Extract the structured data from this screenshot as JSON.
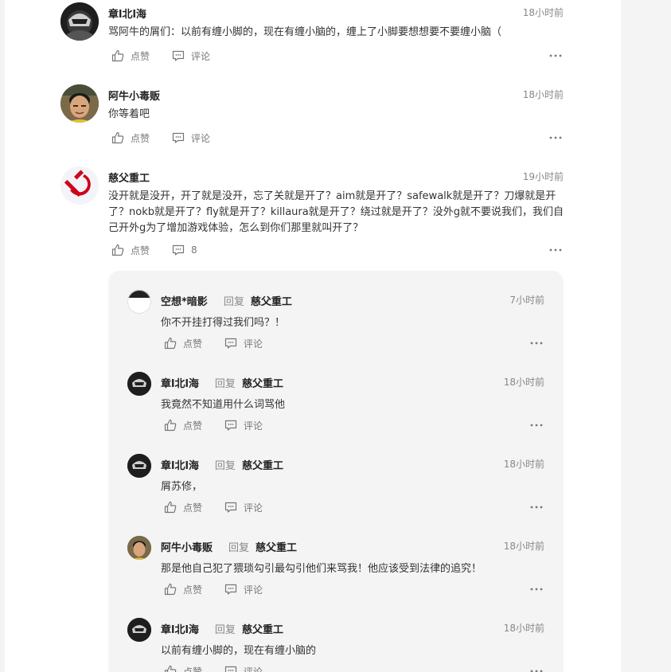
{
  "comments": [
    {
      "author": "章l北l海",
      "time": "18小时前",
      "text": "骂阿牛的屑们：以前有缠小脚的，现在有缠小脑的，缠上了小脚要想想要不要缠小脑（",
      "like_label": "点赞",
      "comment_label": "评论",
      "avatar": "dark-helmet-avatar"
    },
    {
      "author": "阿牛小毒贩",
      "time": "18小时前",
      "text": "你等着吧",
      "like_label": "点赞",
      "comment_label": "评论",
      "avatar": "person-photo-avatar"
    },
    {
      "author": "慈父重工",
      "time": "19小时前",
      "text": "没开就是没开，开了就是没开，忘了关就是开了？aim就是开了？safewalk就是开了？刀爆就是开了？nokb就是开了？fly就是开了？killaura就是开了？绕过就是开了？没外g就不要说我们，我们自己开外g为了增加游戏体验，怎么到你们那里就叫开了？",
      "like_label": "点赞",
      "comment_label": "8",
      "avatar": "hammer-sickle-avatar"
    }
  ],
  "replies": [
    {
      "author": "空想*暗影",
      "reply_label": "回复",
      "target": "慈父重工",
      "time": "7小时前",
      "text": "你不开挂打得过我们吗？！",
      "like_label": "点赞",
      "comment_label": "评论"
    },
    {
      "author": "章l北l海",
      "reply_label": "回复",
      "target": "慈父重工",
      "time": "18小时前",
      "text": "我竟然不知道用什么词骂他",
      "like_label": "点赞",
      "comment_label": "评论"
    },
    {
      "author": "章l北l海",
      "reply_label": "回复",
      "target": "慈父重工",
      "time": "18小时前",
      "text": "屑苏修，",
      "like_label": "点赞",
      "comment_label": "评论"
    },
    {
      "author": "阿牛小毒贩",
      "reply_label": "回复",
      "target": "慈父重工",
      "time": "18小时前",
      "text": "那是他自己犯了猥琐勾引最勾引他们来骂我！他应该受到法律的追究！",
      "like_label": "点赞",
      "comment_label": "评论"
    },
    {
      "author": "章l北l海",
      "reply_label": "回复",
      "target": "慈父重工",
      "time": "18小时前",
      "text": "以前有缠小脚的，现在有缠小脑的",
      "like_label": "点赞",
      "comment_label": "评论"
    }
  ],
  "icons": {
    "like": "thumbs-up-icon",
    "comment": "comment-bubble-icon",
    "more": "more-dots-icon"
  },
  "colors": {
    "background": "#f4f4f4",
    "panel": "#ffffff",
    "muted": "#888888",
    "sickle_red": "#d0021b"
  }
}
